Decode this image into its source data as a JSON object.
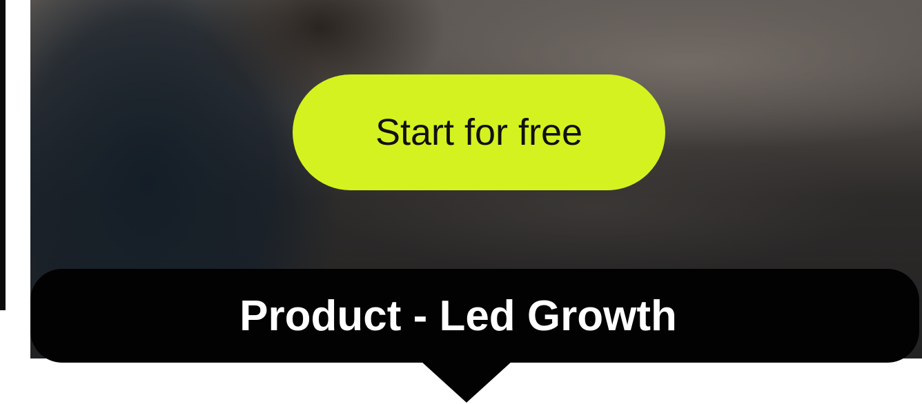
{
  "hero": {
    "cta_label": "Start for free"
  },
  "banner": {
    "title": "Product - Led Growth"
  },
  "colors": {
    "cta_background": "#d4f21f",
    "banner_background": "#020202",
    "banner_text": "#ffffff"
  }
}
